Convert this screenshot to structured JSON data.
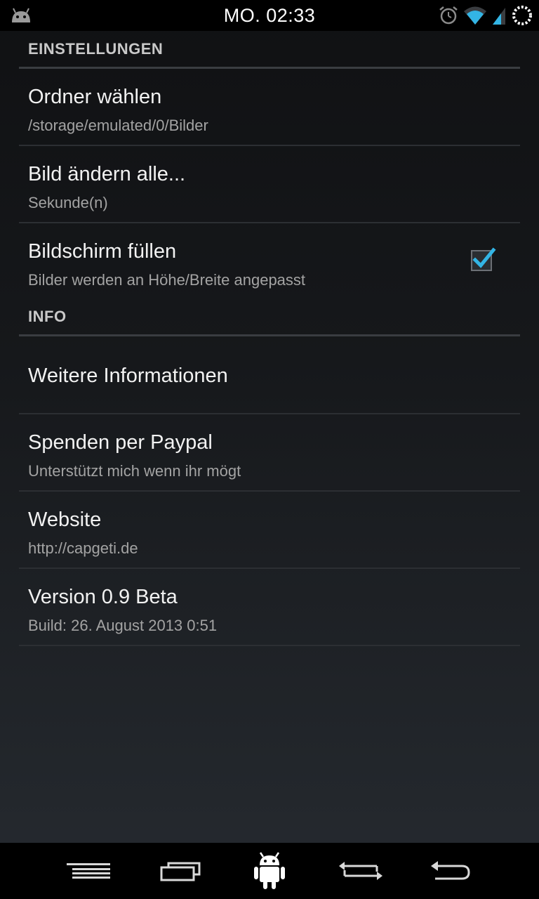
{
  "status_bar": {
    "time": "MO. 02:33",
    "icons": [
      "android-notification-icon",
      "alarm-icon",
      "wifi-icon",
      "signal-icon",
      "battery-charging-icon"
    ]
  },
  "sections": {
    "settings": {
      "header": "EINSTELLUNGEN",
      "items": [
        {
          "title": "Ordner wählen",
          "summary": "/storage/emulated/0/Bilder"
        },
        {
          "title": "Bild ändern alle...",
          "summary": "Sekunde(n)"
        },
        {
          "title": "Bildschirm füllen",
          "summary": "Bilder werden an Höhe/Breite angepasst",
          "checked": true
        }
      ]
    },
    "info": {
      "header": "INFO",
      "items": [
        {
          "title": "Weitere Informationen"
        },
        {
          "title": "Spenden per Paypal",
          "summary": "Unterstützt mich wenn ihr mögt"
        },
        {
          "title": "Website",
          "summary": "http://capgeti.de"
        },
        {
          "title": "Version 0.9 Beta",
          "summary": "Build: 26. August 2013 0:51"
        }
      ]
    }
  },
  "nav_bar": {
    "buttons": [
      "menu-icon",
      "recent-apps-icon",
      "android-home-icon",
      "rotate-icon",
      "back-icon"
    ]
  },
  "colors": {
    "accent": "#33b5e5",
    "title_text": "#f2f2f2",
    "summary_text": "#a3a3a3",
    "header_text": "#c9c9c9"
  }
}
